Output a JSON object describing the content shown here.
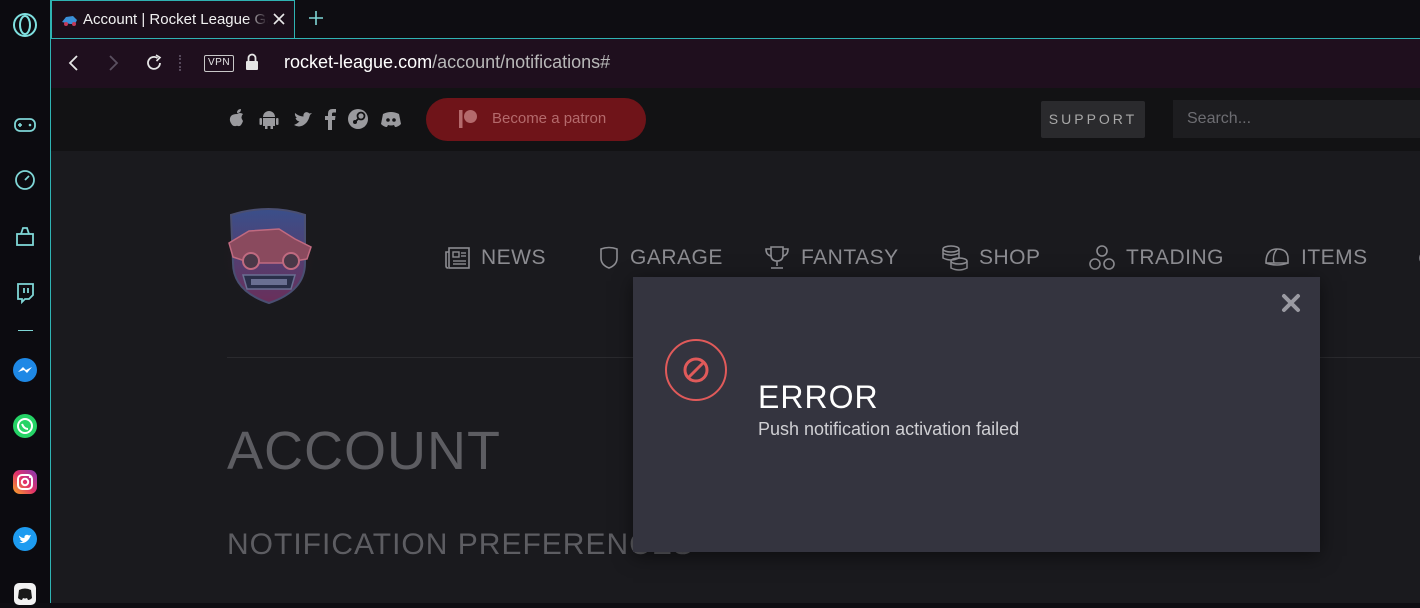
{
  "browser": {
    "tab": {
      "title": "Account | Rocket League Garage",
      "favicon": "rocket-league-garage-favicon"
    },
    "vpn_label": "VPN",
    "url": {
      "host": "rocket-league.com",
      "path": "/account/notifications#"
    },
    "accent_color": "#2fb3b3"
  },
  "sidebar": {
    "items": [
      {
        "name": "opera-logo-icon"
      },
      {
        "name": "gx-controller-icon"
      },
      {
        "name": "speed-dial-icon"
      },
      {
        "name": "cleaner-icon"
      },
      {
        "name": "twitch-icon"
      },
      {
        "name": "messenger-icon"
      },
      {
        "name": "whatsapp-icon"
      },
      {
        "name": "instagram-icon"
      },
      {
        "name": "twitter-icon"
      },
      {
        "name": "discord-icon"
      }
    ]
  },
  "topbar": {
    "socials": [
      "apple-icon",
      "android-icon",
      "twitter-icon",
      "facebook-icon",
      "steam-icon",
      "discord-icon"
    ],
    "patron_label": "Become a patron",
    "support_label": "SUPPORT",
    "search_placeholder": "Search..."
  },
  "mainnav": {
    "items": [
      {
        "label": "NEWS",
        "icon": "newspaper-icon"
      },
      {
        "label": "GARAGE",
        "icon": "shield-icon"
      },
      {
        "label": "FANTASY",
        "icon": "trophy-icon"
      },
      {
        "label": "SHOP",
        "icon": "coins-icon"
      },
      {
        "label": "TRADING",
        "icon": "trading-icon"
      },
      {
        "label": "ITEMS",
        "icon": "helmet-icon"
      }
    ]
  },
  "page": {
    "heading": "ACCOUNT",
    "subheading": "NOTIFICATION PREFERENCES"
  },
  "modal": {
    "title": "ERROR",
    "message": "Push notification activation failed",
    "icon": "error-ban-icon",
    "icon_color": "#e05a5a"
  }
}
